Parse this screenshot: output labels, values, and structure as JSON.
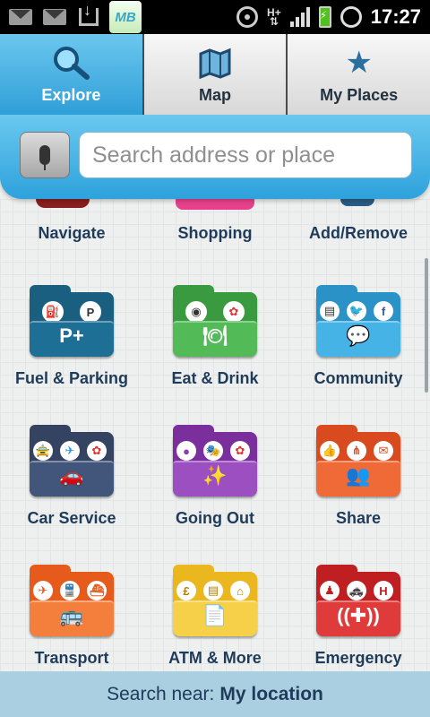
{
  "statusbar": {
    "app_icon_text": "MB",
    "network": "H+",
    "time": "17:27",
    "icons": [
      "gmail-icon",
      "gmail-icon",
      "download-icon",
      "app-icon",
      "gps-icon",
      "network-icon",
      "signal-icon",
      "battery-icon",
      "alarm-icon"
    ]
  },
  "tabs": [
    {
      "label": "Explore",
      "icon": "magnifier-icon",
      "active": true
    },
    {
      "label": "Map",
      "icon": "map-icon",
      "active": false
    },
    {
      "label": "My Places",
      "icon": "star-icon",
      "active": false
    }
  ],
  "search": {
    "placeholder": "Search address or place",
    "value": ""
  },
  "categories": [
    {
      "label": "Navigate"
    },
    {
      "label": "Shopping"
    },
    {
      "label": "Add/Remove"
    },
    {
      "label": "Fuel & Parking",
      "color": "#1b5f80",
      "icon_text": "P+"
    },
    {
      "label": "Eat & Drink",
      "color": "#44b04a"
    },
    {
      "label": "Community",
      "color": "#3aa8dd"
    },
    {
      "label": "Car Service",
      "color": "#3b4b66"
    },
    {
      "label": "Going Out",
      "color": "#8d3cae"
    },
    {
      "label": "Share",
      "color": "#ec5a2a"
    },
    {
      "label": "Transport",
      "color": "#ef6b2a"
    },
    {
      "label": "ATM & More",
      "color": "#f4c530"
    },
    {
      "label": "Emergency",
      "color": "#d8282a"
    }
  ],
  "bottombar": {
    "prefix": "Search near:",
    "location": "My location"
  }
}
